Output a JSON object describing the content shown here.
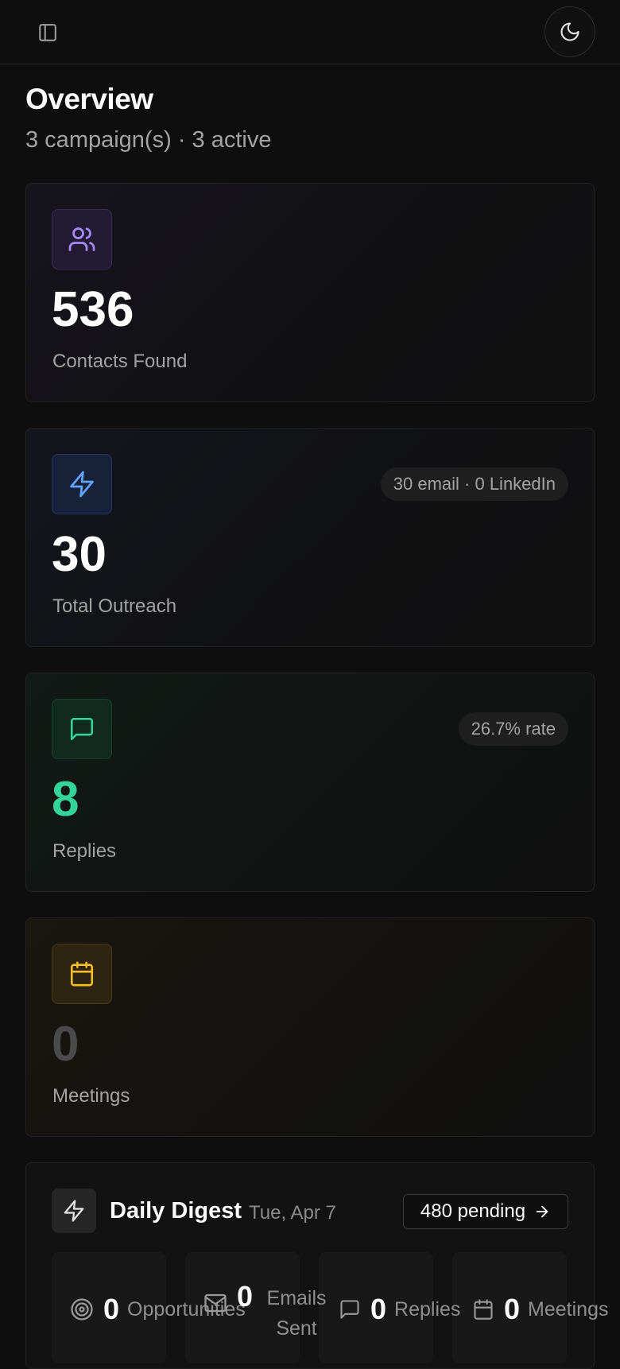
{
  "header": {
    "sidebar_toggle_icon": "panel-left-icon",
    "theme_toggle_icon": "moon-icon"
  },
  "page": {
    "title": "Overview",
    "subtitle": "3 campaign(s) · 3 active"
  },
  "cards": {
    "contacts": {
      "icon": "users-icon",
      "value": "536",
      "label": "Contacts Found",
      "accent": "#a78bfa"
    },
    "outreach": {
      "icon": "zap-icon",
      "value": "30",
      "label": "Total Outreach",
      "badge": "30 email · 0 LinkedIn",
      "accent": "#60a5fa"
    },
    "replies": {
      "icon": "message-square-icon",
      "value": "8",
      "label": "Replies",
      "badge": "26.7% rate",
      "accent": "#34d399"
    },
    "meetings": {
      "icon": "calendar-icon",
      "value": "0",
      "label": "Meetings",
      "accent": "#fbbf24"
    }
  },
  "digest": {
    "icon": "zap-icon",
    "title": "Daily Digest",
    "date": "Tue, Apr 7",
    "pending_label": "480 pending",
    "pending_icon": "arrow-right-icon",
    "stats": [
      {
        "icon": "target-icon",
        "value": "0",
        "label": "Opportunities"
      },
      {
        "icon": "mail-icon",
        "value": "0",
        "label": "Emails Sent"
      },
      {
        "icon": "message-square-icon",
        "value": "0",
        "label": "Replies"
      },
      {
        "icon": "calendar-icon",
        "value": "0",
        "label": "Meetings"
      }
    ]
  }
}
